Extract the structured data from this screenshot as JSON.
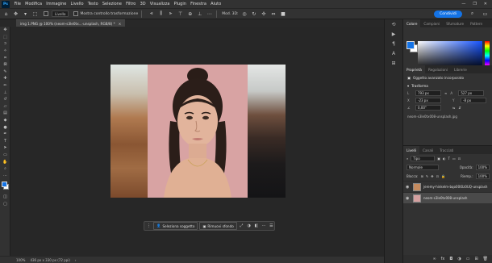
{
  "menubar": {
    "logo": "Ps",
    "items": [
      "File",
      "Modifica",
      "Immagine",
      "Livello",
      "Testo",
      "Selezione",
      "Filtro",
      "3D",
      "Visualizza",
      "Plugin",
      "Finestra",
      "Aiuto"
    ],
    "controls": [
      "—",
      "❐",
      "✕"
    ]
  },
  "options": {
    "mode_value": "Livello",
    "checkbox_label": "Mostra controllo trasformazione",
    "mode3d_label": "Mod. 3D:",
    "share_label": "Condividi"
  },
  "document": {
    "tab_title": "img 1.PNG @ 100% (neom-s3le0tx...-unsplash, RGB/8) *",
    "tab_close": "×"
  },
  "contextbar": {
    "select_subject": "Seleziona soggetto",
    "remove_bg": "Rimuovi sfondo"
  },
  "status": {
    "zoom": "100%",
    "docinfo": "436 px x 330 px (72 ppi)"
  },
  "color_panel": {
    "tabs": [
      "Colore",
      "Campioni",
      "Sfumature",
      "Pattern"
    ],
    "fg": "#1473e6",
    "bg": "#ffffff"
  },
  "properties": {
    "tabs": [
      "Proprietà",
      "Regolazioni",
      "Librerie"
    ],
    "subtitle": "Oggetto avanzato incorporato",
    "transform_label": "Trasforma",
    "w": "793 px",
    "h": "527 px",
    "x": "-23 px",
    "y": "-8 px",
    "angle": "0,00°",
    "filename": "neom-s3le0tx008-unsplash.jpg"
  },
  "layers": {
    "tabs": [
      "Livelli",
      "Canali",
      "Tracciati"
    ],
    "filter": "Tipo",
    "blend": "Normale",
    "opacity_label": "Opacità:",
    "opacity": "100%",
    "lock_label": "Blocca:",
    "fill_label": "Riemp.:",
    "fill": "100%",
    "items": [
      {
        "name": "jeremy-hinkelm-bqo00t0z0UQ-unsplash"
      },
      {
        "name": "neom-s3le0tx008-unsplash"
      }
    ]
  },
  "icons": {
    "tools": [
      "move-icon",
      "marquee-icon",
      "lasso-icon",
      "magic-wand-icon",
      "crop-icon",
      "frame-icon",
      "eyedropper-icon",
      "healing-icon",
      "brush-icon",
      "stamp-icon",
      "history-brush-icon",
      "eraser-icon",
      "gradient-icon",
      "blur-icon",
      "dodge-icon",
      "pen-icon",
      "type-icon",
      "path-select-icon",
      "rectangle-icon",
      "hand-icon",
      "zoom-icon",
      "more-icon"
    ]
  }
}
